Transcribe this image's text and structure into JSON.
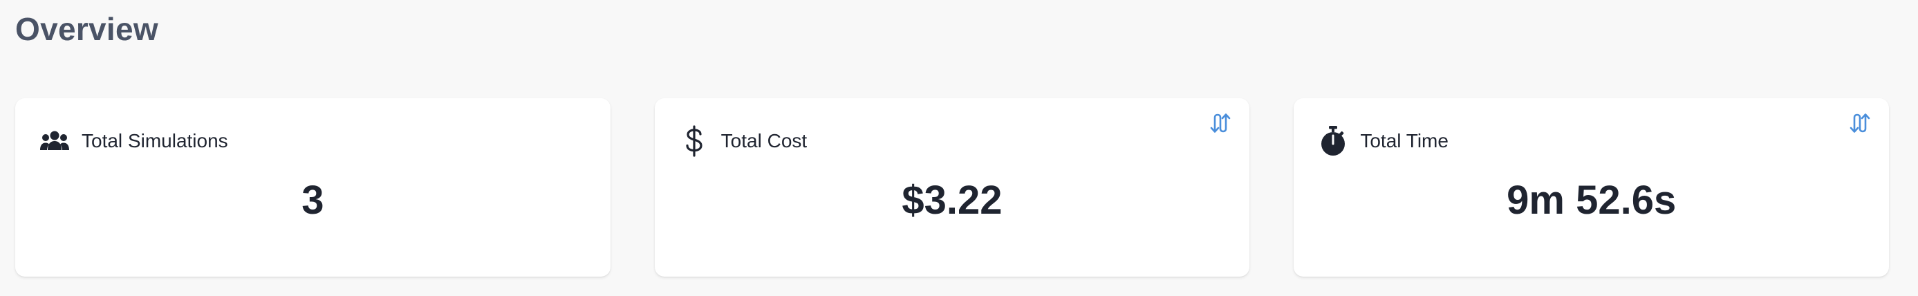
{
  "page": {
    "title": "Overview"
  },
  "cards": [
    {
      "label": "Total Simulations",
      "value": "3",
      "icon": "users-icon",
      "has_toggle": false
    },
    {
      "label": "Total Cost",
      "value": "$3.22",
      "icon": "dollar-icon",
      "has_toggle": true,
      "toggle_icon": "swap-vertical-icon"
    },
    {
      "label": "Total Time",
      "value": "9m 52.6s",
      "icon": "stopwatch-icon",
      "has_toggle": true,
      "toggle_icon": "swap-vertical-icon"
    }
  ],
  "colors": {
    "background": "#f8f8f8",
    "card": "#ffffff",
    "title": "#4a5366",
    "text": "#1f2430",
    "accent": "#4a8edb"
  }
}
